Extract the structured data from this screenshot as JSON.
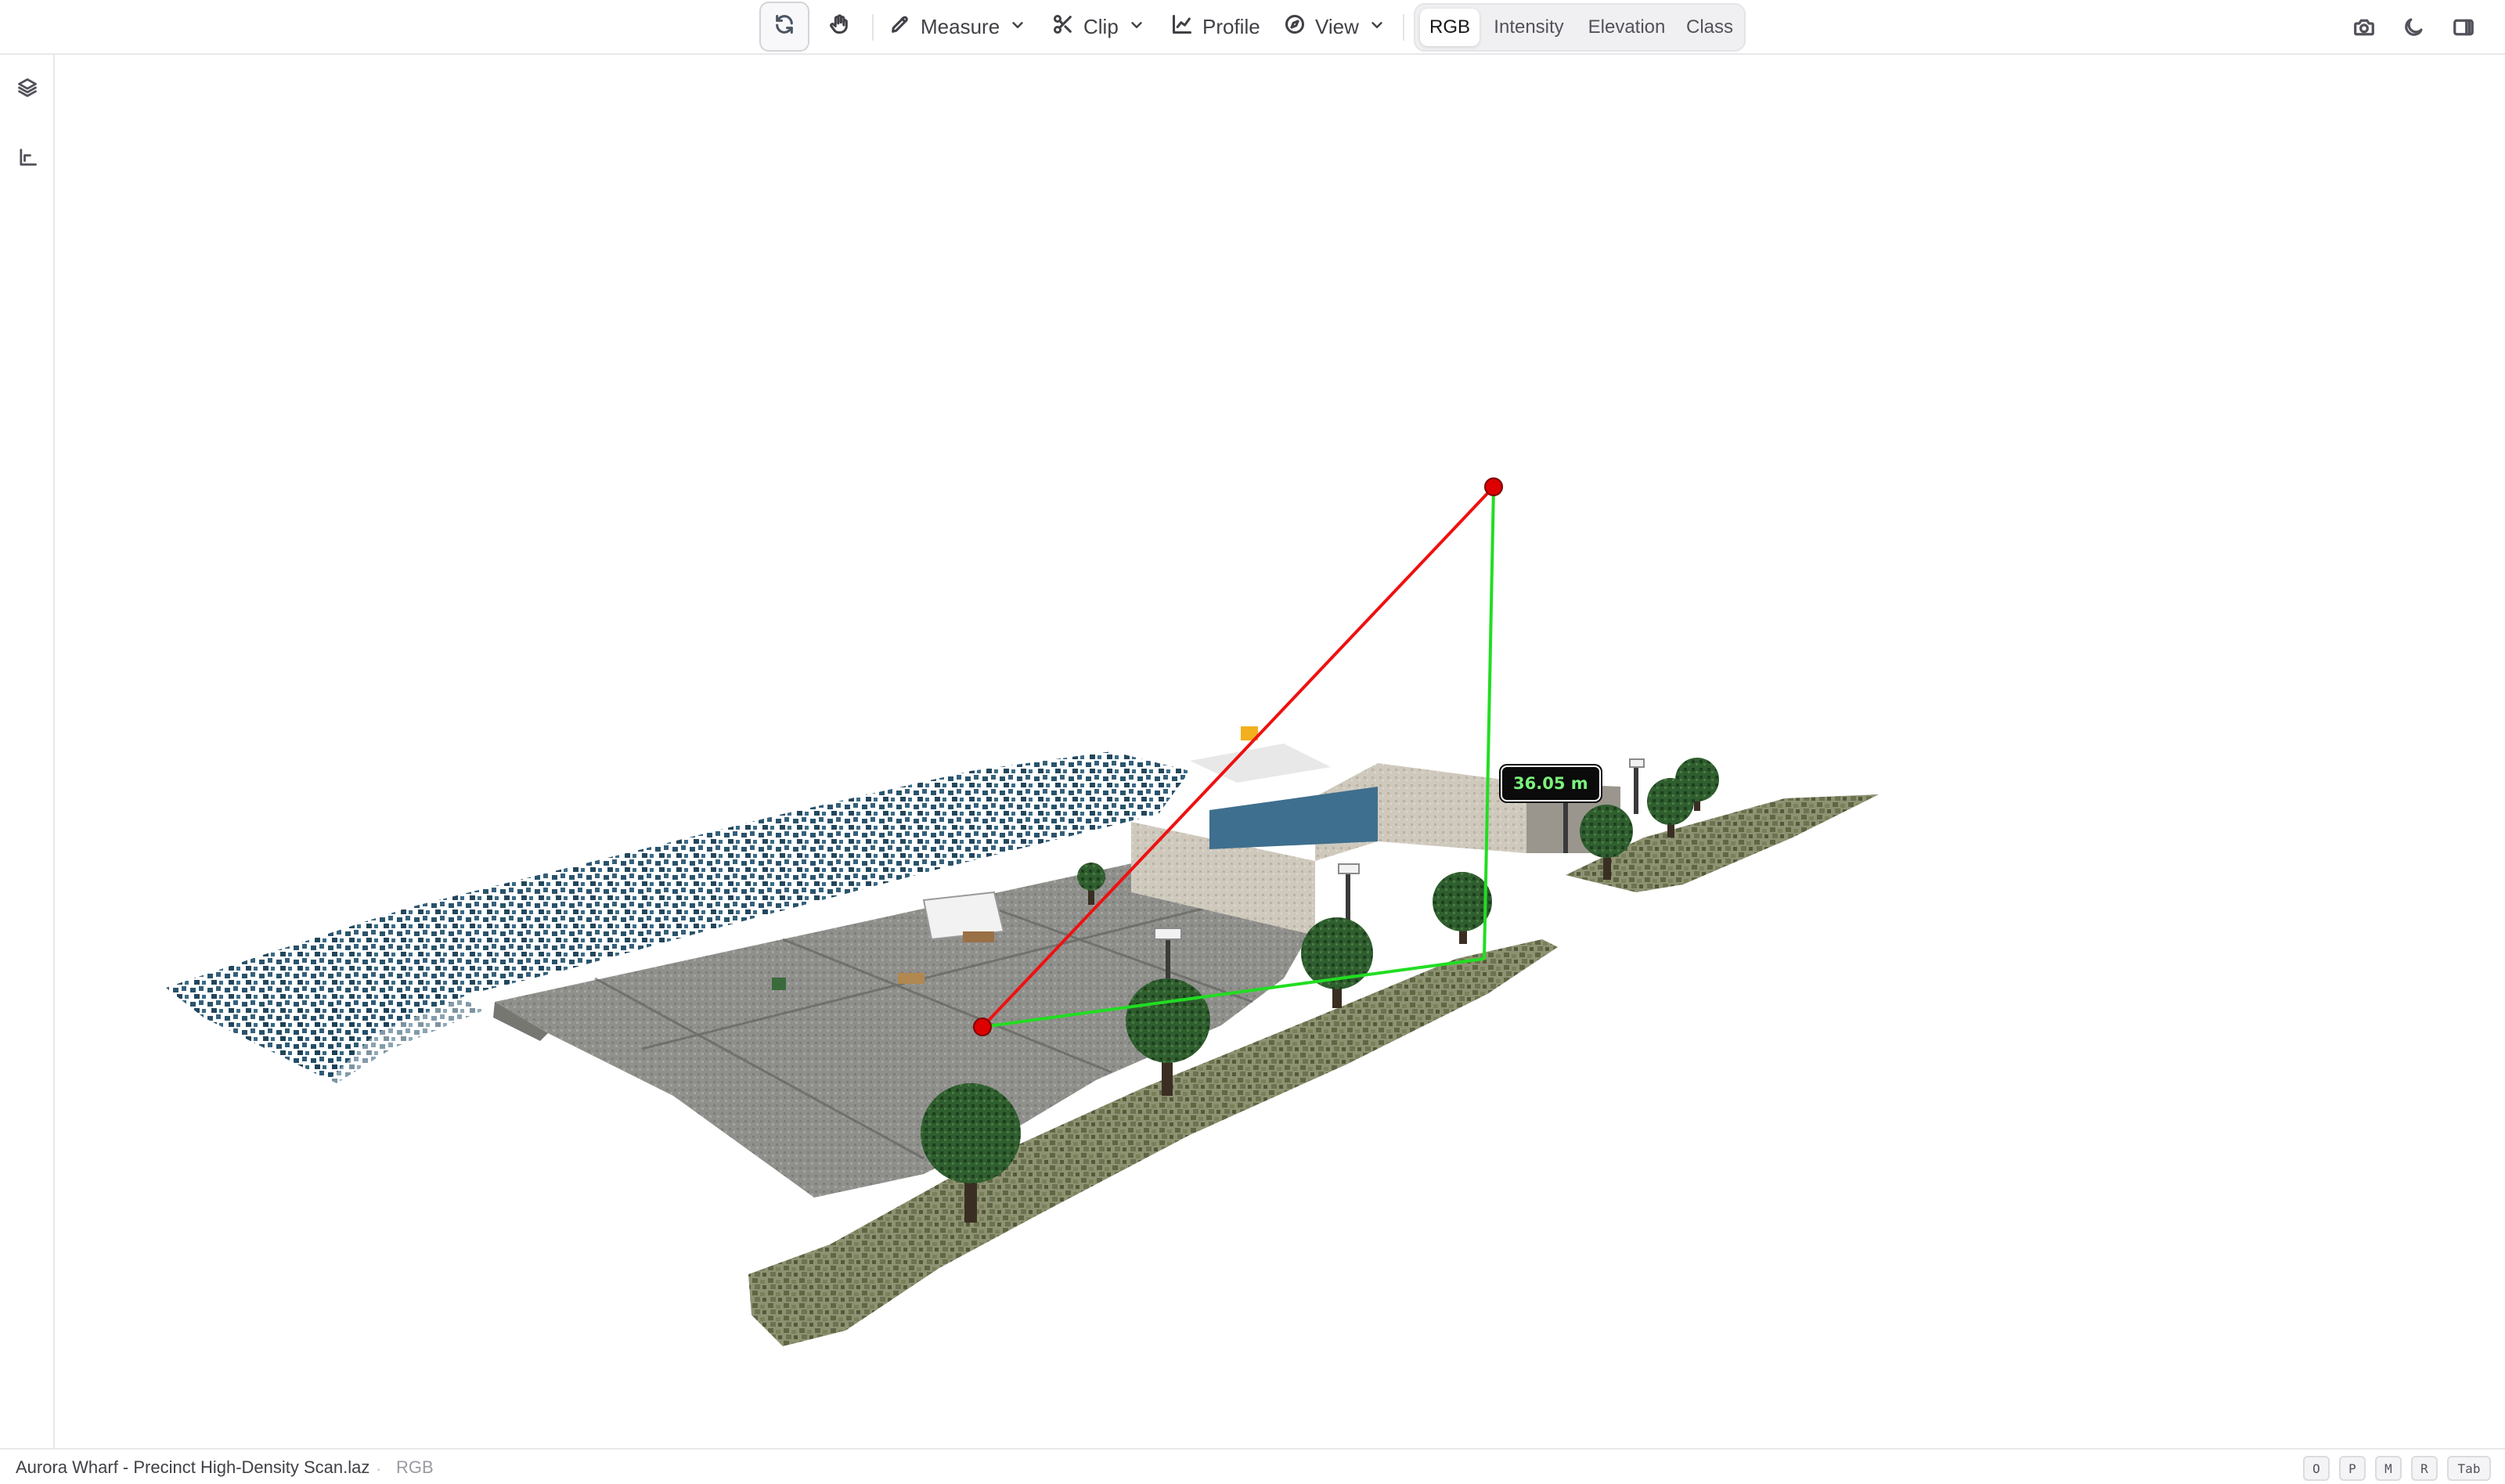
{
  "toolbar": {
    "orbit_icon": "orbit-rotate-icon",
    "pan_icon": "hand-pan-icon",
    "measure_label": "Measure",
    "clip_label": "Clip",
    "profile_label": "Profile",
    "view_label": "View",
    "color_modes": [
      "RGB",
      "Intensity",
      "Elevation",
      "Class"
    ],
    "active_color_mode": "RGB",
    "right_icons": [
      "camera-icon",
      "moon-icon",
      "panel-toggle-icon"
    ]
  },
  "sidebar": {
    "items": [
      {
        "icon": "layers-icon"
      },
      {
        "icon": "axes-icon"
      }
    ]
  },
  "viewport": {
    "measurement": {
      "distance_label": "36.05 m",
      "hypotenuse_color": "#ee1111",
      "leg_color": "#22dd22",
      "point_color": "#dd0000"
    }
  },
  "statusbar": {
    "file_name": "Aurora Wharf - Precinct High-Density Scan.laz",
    "separator": "·",
    "color_mode": "RGB",
    "shortcuts": [
      "O",
      "P",
      "M",
      "R",
      "Tab"
    ]
  },
  "colors": {
    "accent": "#18181b",
    "border": "#e8e8ea",
    "water_points": "#1e4a63",
    "ground": "#8d8d8b",
    "grass_points": "#6f7651",
    "tree_foliage": "#2c5a2c"
  }
}
